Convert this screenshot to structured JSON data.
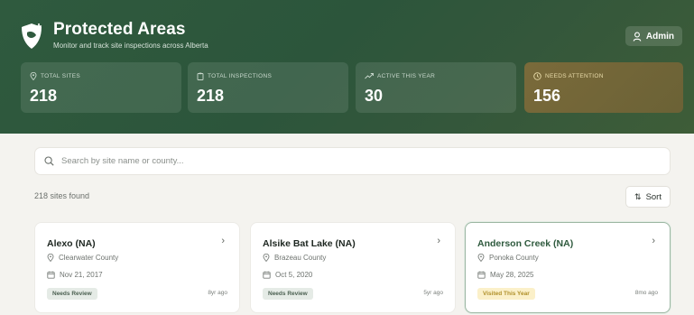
{
  "app": {
    "title": "Protected Areas",
    "subtitle": "Monitor and track site inspections across Alberta",
    "user_button": "Admin"
  },
  "stats": [
    {
      "label": "TOTAL SITES",
      "value": "218",
      "icon": "map-pin-icon"
    },
    {
      "label": "TOTAL INSPECTIONS",
      "value": "218",
      "icon": "clipboard-icon"
    },
    {
      "label": "ACTIVE THIS YEAR",
      "value": "30",
      "icon": "trend-up-icon"
    },
    {
      "label": "NEEDS ATTENTION",
      "value": "156",
      "icon": "clock-icon"
    }
  ],
  "search": {
    "placeholder": "Search by site name or county...",
    "value": ""
  },
  "results": {
    "count_text": "218 sites found",
    "sort_label": "Sort"
  },
  "cards": [
    {
      "name": "Alexo (NA)",
      "county": "Clearwater County",
      "date": "Nov 21, 2017",
      "status": "Needs Review",
      "ago": "8yr ago"
    },
    {
      "name": "Alsike Bat Lake (NA)",
      "county": "Brazeau County",
      "date": "Oct 5, 2020",
      "status": "Needs Review",
      "ago": "5yr ago"
    },
    {
      "name": "Anderson Creek (NA)",
      "county": "Ponoka County",
      "date": "May 28, 2025",
      "status": "Visited This Year",
      "ago": "8mo ago"
    }
  ],
  "colors": {
    "header_green": "#2f5a3e",
    "attention_card": "#7a6a3a",
    "review_badge_bg": "#e5ebe6",
    "visited_badge_bg": "#fbf0c9",
    "background": "#f4f3ef"
  }
}
